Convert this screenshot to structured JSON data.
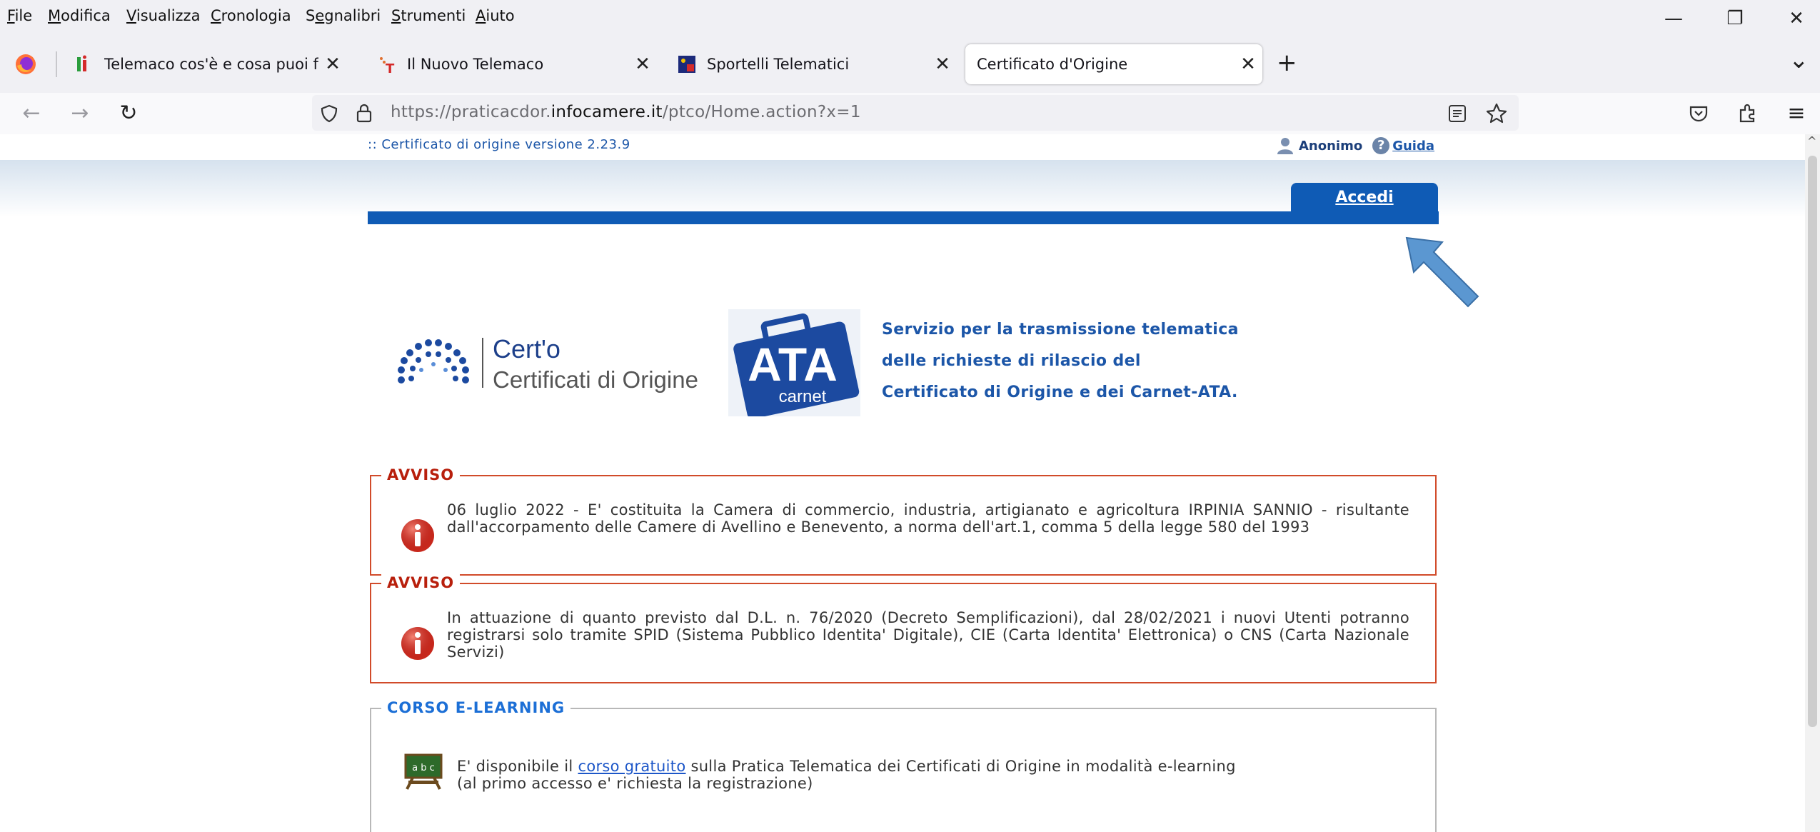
{
  "menubar": {
    "items": [
      {
        "accel": "F",
        "rest": "ile"
      },
      {
        "accel": "M",
        "rest": "odifica"
      },
      {
        "accel": "V",
        "rest": "isualizza"
      },
      {
        "accel": "C",
        "rest": "ronologia"
      },
      {
        "pre": "S",
        "accel": "e",
        "rest": "gnalibri"
      },
      {
        "accel": "S",
        "rest": "trumenti"
      },
      {
        "accel": "A",
        "rest": "iuto"
      }
    ],
    "minimize": "—",
    "restore": "❐",
    "close": "✕"
  },
  "tabs": [
    {
      "title": "Telemaco cos'è e cosa puoi fare",
      "active": false
    },
    {
      "title": "Il Nuovo Telemaco",
      "active": false
    },
    {
      "title": "Sportelli Telematici",
      "active": false
    },
    {
      "title": "Certificato d'Origine",
      "active": true
    }
  ],
  "tab_close": "✕",
  "new_tab": "+",
  "tab_list": "⌄",
  "nav": {
    "back": "←",
    "forward": "→",
    "reload": "↻",
    "url_prefix": "https://praticacdor.",
    "url_domain": "infocamere.it",
    "url_path": "/ptco/Home.action?x=1",
    "menu": "≡"
  },
  "page": {
    "version": ":: Certificato di origine versione 2.23.9",
    "user": "Anonimo",
    "help": "Guida",
    "accedi": "Accedi",
    "certo_name": "Cert'o",
    "certo_sub": "Certificati di Origine",
    "ata_big": "ATA",
    "ata_small": "carnet",
    "service_lines": [
      "Servizio per la trasmissione telematica",
      "delle richieste di rilascio del",
      "Certificato di Origine e dei Carnet-ATA."
    ],
    "notices": [
      {
        "legend": "AVVISO",
        "text": "06 luglio 2022 - E' costituita la Camera di commercio, industria, artigianato e agricoltura IRPINIA SANNIO - risultante dall'accorpamento delle Camere di Avellino e Benevento, a norma dell'art.1, comma 5 della legge 580 del 1993"
      },
      {
        "legend": "AVVISO",
        "text": "In attuazione di quanto previsto dal D.L. n. 76/2020 (Decreto Semplificazioni), dal 28/02/2021 i nuovi Utenti potranno registrarsi solo tramite SPID (Sistema Pubblico Identita' Digitale), CIE (Carta Identita' Elettronica) o CNS (Carta Nazionale Servizi)"
      }
    ],
    "elearning": {
      "legend": "CORSO E-LEARNING",
      "text_before": "E' disponibile il ",
      "link": "corso gratuito",
      "text_after": " sulla Pratica Telematica dei Certificati di Origine in modalità e-learning",
      "line2": "(al primo accesso e' richiesta la registrazione)",
      "board_text": "a b c"
    }
  },
  "colors": {
    "brand_blue": "#0f5bb5",
    "notice_red": "#d14b2a",
    "arrow_blue": "#5b97d1"
  }
}
